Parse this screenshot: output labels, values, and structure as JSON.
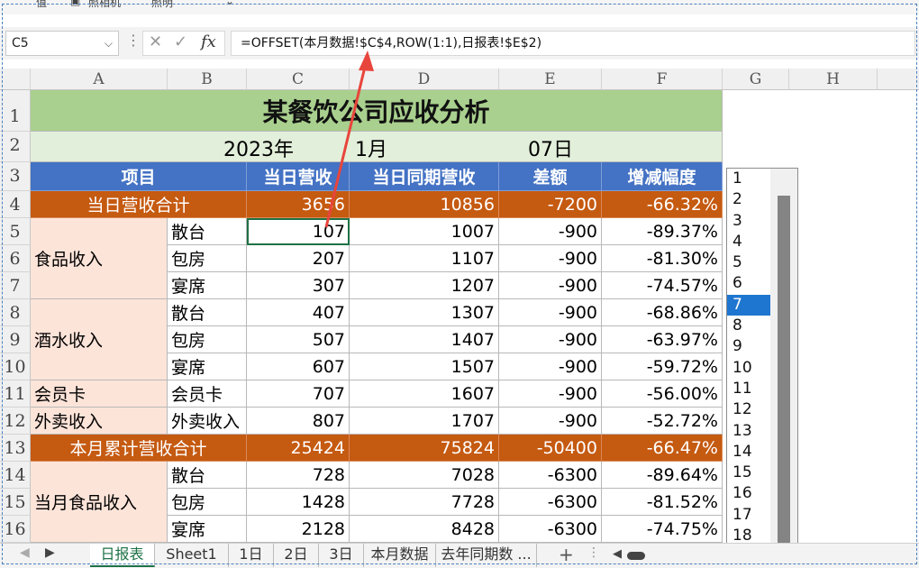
{
  "ribbon": {
    "btn1": "值",
    "btn2": "照相机",
    "btn3": "照明"
  },
  "formula_bar": {
    "name_box": "C5",
    "cancel_glyph": "✕",
    "enter_glyph": "✓",
    "fx_label": "fx",
    "formula": "=OFFSET(本月数据!$C$4,ROW(1:1),日报表!$E$2)"
  },
  "columns": [
    "A",
    "B",
    "C",
    "D",
    "E",
    "F",
    "G",
    "H"
  ],
  "rows": [
    "1",
    "2",
    "3",
    "4",
    "5",
    "6",
    "7",
    "8",
    "9",
    "10",
    "11",
    "12",
    "13",
    "14",
    "15",
    "16"
  ],
  "sheet": {
    "title": "某餐饮公司应收分析",
    "date": {
      "year": "2023年",
      "month": "1月",
      "day": "07日"
    },
    "headers": {
      "item": "项目",
      "today": "当日营收",
      "same_period": "当日同期营收",
      "diff": "差额",
      "rate": "增减幅度"
    },
    "daily_total": {
      "label": "当日营收合计",
      "today": "3656",
      "same": "10856",
      "diff": "-7200",
      "rate": "-66.32%"
    },
    "groups": {
      "food": "食品收入",
      "drink": "酒水收入",
      "member": "会员卡",
      "takeout": "外卖收入",
      "month_food": "当月食品收入"
    },
    "month_total": {
      "label": "本月累计营收合计",
      "today": "25424",
      "same": "75824",
      "diff": "-50400",
      "rate": "-66.47%"
    },
    "rows": [
      {
        "sub": "散台",
        "today": "107",
        "same": "1007",
        "diff": "-900",
        "rate": "-89.37%"
      },
      {
        "sub": "包房",
        "today": "207",
        "same": "1107",
        "diff": "-900",
        "rate": "-81.30%"
      },
      {
        "sub": "宴席",
        "today": "307",
        "same": "1207",
        "diff": "-900",
        "rate": "-74.57%"
      },
      {
        "sub": "散台",
        "today": "407",
        "same": "1307",
        "diff": "-900",
        "rate": "-68.86%"
      },
      {
        "sub": "包房",
        "today": "507",
        "same": "1407",
        "diff": "-900",
        "rate": "-63.97%"
      },
      {
        "sub": "宴席",
        "today": "607",
        "same": "1507",
        "diff": "-900",
        "rate": "-59.72%"
      },
      {
        "sub": "会员卡",
        "today": "707",
        "same": "1607",
        "diff": "-900",
        "rate": "-56.00%"
      },
      {
        "sub": "外卖收入",
        "today": "807",
        "same": "1707",
        "diff": "-900",
        "rate": "-52.72%"
      }
    ],
    "month_rows": [
      {
        "sub": "散台",
        "today": "728",
        "same": "7028",
        "diff": "-6300",
        "rate": "-89.64%"
      },
      {
        "sub": "包房",
        "today": "1428",
        "same": "7728",
        "diff": "-6300",
        "rate": "-81.52%"
      },
      {
        "sub": "宴席",
        "today": "2128",
        "same": "8428",
        "diff": "-6300",
        "rate": "-74.75%"
      }
    ]
  },
  "listbox": {
    "items": [
      "1",
      "2",
      "3",
      "4",
      "5",
      "6",
      "7",
      "8",
      "9",
      "10",
      "11",
      "12",
      "13",
      "14",
      "15",
      "16",
      "17",
      "18"
    ],
    "selected": "7"
  },
  "tabs": {
    "items": [
      "日报表",
      "Sheet1",
      "1日",
      "2日",
      "3日",
      "本月数据",
      "去年同期数 ..."
    ],
    "active": "日报表",
    "add": "+"
  },
  "colors": {
    "orange": "#c55a11",
    "blue": "#4472c4",
    "green": "#a9d08e",
    "pink": "#fde4d9",
    "arrow": "#e8453c"
  }
}
